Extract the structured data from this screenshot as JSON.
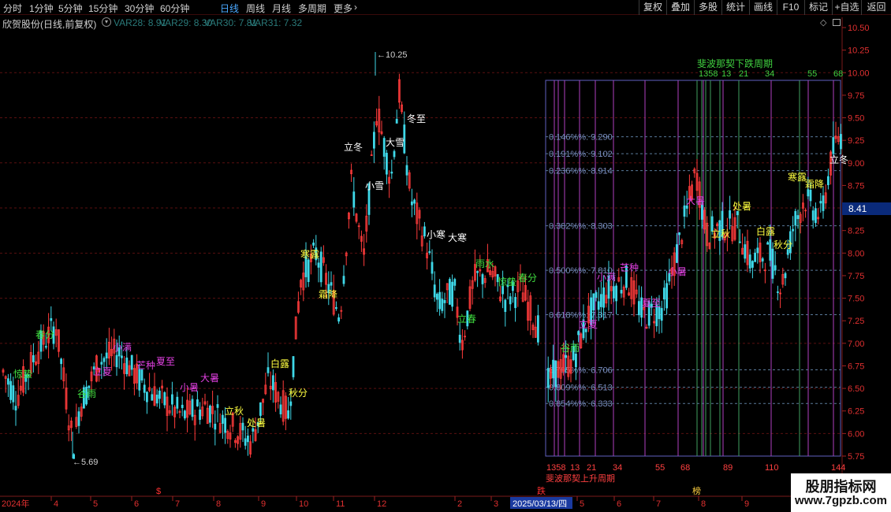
{
  "toolbar": {
    "tabs": [
      {
        "label": "分时",
        "active": false
      },
      {
        "label": "1分钟",
        "active": false
      },
      {
        "label": "5分钟",
        "active": false
      },
      {
        "label": "15分钟",
        "active": false
      },
      {
        "label": "30分钟",
        "active": false
      },
      {
        "label": "60分钟",
        "active": false
      },
      {
        "label": "日线",
        "active": true
      },
      {
        "label": "周线",
        "active": false
      },
      {
        "label": "月线",
        "active": false
      },
      {
        "label": "多周期",
        "active": false
      },
      {
        "label": "更多",
        "active": false
      }
    ],
    "more_icon": "chevron-right-icon",
    "right_buttons": [
      "复权",
      "叠加",
      "多股",
      "统计",
      "画线",
      "F10",
      "标记",
      "+自选",
      "返回"
    ]
  },
  "info": {
    "title": "欣贺股份(日线,前复权)",
    "dropdown_icon": "chevron-down-circle-icon",
    "vars": [
      {
        "label": "VAR28: 8.91",
        "color": "#2a7a7a"
      },
      {
        "label": "VAR29: 8.30",
        "color": "#2a7a7a"
      },
      {
        "label": "VAR30: 7.81",
        "color": "#2a7a7a"
      },
      {
        "label": "VAR31: 7.32",
        "color": "#2a7a7a"
      }
    ],
    "diamond_icon": "diamond-icon",
    "window_icon": "window-icon"
  },
  "price_axis": {
    "ticks": [
      "10.50",
      "10.25",
      "10.00",
      "9.75",
      "9.50",
      "9.25",
      "9.00",
      "8.75",
      "8.50",
      "8.25",
      "8.00",
      "7.75",
      "7.50",
      "7.25",
      "7.00",
      "6.75",
      "6.50",
      "6.25",
      "6.00",
      "5.75"
    ],
    "current_price": "8.41"
  },
  "markers": {
    "high": "10.25",
    "low": "5.69"
  },
  "fib_box": {
    "title": "斐波那契下跌周期",
    "top_numbers": [
      "1358",
      "13",
      "21",
      "34",
      "55",
      "68"
    ],
    "bottom_numbers": [
      "1358",
      "13",
      "21",
      "34",
      "55",
      "68",
      "89",
      "110",
      "144"
    ],
    "bottom_title": "斐波那契上升周期",
    "levels": [
      {
        "label": "0.146%%: 9.290"
      },
      {
        "label": "0.191%%: 9.102"
      },
      {
        "label": "0.236%%: 8.914"
      },
      {
        "label": "0.382%%: 8.303"
      },
      {
        "label": "0.500%%: 7.810"
      },
      {
        "label": "0.618%%: 7.317"
      },
      {
        "label": "0.785%%: 6.706"
      },
      {
        "label": "0.809%%: 6.513"
      },
      {
        "label": "0.854%%: 6.333"
      }
    ]
  },
  "solar_terms": [
    {
      "text": "惊蛰",
      "color": "#40e040"
    },
    {
      "text": "春分",
      "color": "#40e040"
    },
    {
      "text": "谷雨",
      "color": "#40e040"
    },
    {
      "text": "立夏",
      "color": "#e040e0"
    },
    {
      "text": "小满",
      "color": "#e040e0"
    },
    {
      "text": "芒种",
      "color": "#e040e0"
    },
    {
      "text": "夏至",
      "color": "#e040e0"
    },
    {
      "text": "小暑",
      "color": "#e040e0"
    },
    {
      "text": "大暑",
      "color": "#e040e0"
    },
    {
      "text": "立秋",
      "color": "#ffff40"
    },
    {
      "text": "处暑",
      "color": "#ffff40"
    },
    {
      "text": "白露",
      "color": "#ffff40"
    },
    {
      "text": "秋分",
      "color": "#ffff40"
    },
    {
      "text": "寒露",
      "color": "#ffff40"
    },
    {
      "text": "霜降",
      "color": "#ffff40"
    },
    {
      "text": "立冬",
      "color": "#ffffff"
    },
    {
      "text": "小雪",
      "color": "#ffffff"
    },
    {
      "text": "大雪",
      "color": "#ffffff"
    },
    {
      "text": "冬至",
      "color": "#ffffff"
    },
    {
      "text": "小寒",
      "color": "#ffffff"
    },
    {
      "text": "大寒",
      "color": "#ffffff"
    },
    {
      "text": "立春",
      "color": "#40e040"
    },
    {
      "text": "雨水",
      "color": "#40e040"
    },
    {
      "text": "惊蛰",
      "color": "#40e040"
    },
    {
      "text": "春分",
      "color": "#40e040"
    },
    {
      "text": "谷雨",
      "color": "#40e040"
    },
    {
      "text": "立夏",
      "color": "#e040e0"
    },
    {
      "text": "小满",
      "color": "#e040e0"
    },
    {
      "text": "芒种",
      "color": "#e040e0"
    },
    {
      "text": "夏至",
      "color": "#e040e0"
    },
    {
      "text": "小暑",
      "color": "#e040e0"
    },
    {
      "text": "大暑",
      "color": "#e040e0"
    },
    {
      "text": "立秋",
      "color": "#ffff40"
    },
    {
      "text": "处暑",
      "color": "#ffff40"
    },
    {
      "text": "白露",
      "color": "#ffff40"
    },
    {
      "text": "秋分",
      "color": "#ffff40"
    },
    {
      "text": "寒露",
      "color": "#ffff40"
    },
    {
      "text": "霜降",
      "color": "#ffff40"
    },
    {
      "text": "立冬",
      "color": "#ffffff"
    }
  ],
  "time_axis": {
    "labels": [
      "2024年",
      "4",
      "5",
      "6",
      "7",
      "8",
      "9",
      "10",
      "11",
      "12",
      "2",
      "3",
      "2025/03/13/四",
      "5",
      "6",
      "7",
      "8",
      "9"
    ]
  },
  "event_marks": [
    {
      "text": "$",
      "color": "#ff3030"
    },
    {
      "text": "跌",
      "color": "#ff3030"
    },
    {
      "text": "榜",
      "color": "#ffd040"
    }
  ],
  "watermark": {
    "title": "股朋指标网",
    "url": "www.7gpzb.com"
  },
  "colors": {
    "up": "#ff3b3b",
    "down": "#3fd8e8",
    "grid": "#5a1010",
    "fib_box": "#6060c0",
    "fib_vertical": "#b040c0",
    "fib_green": "#40a060"
  }
}
